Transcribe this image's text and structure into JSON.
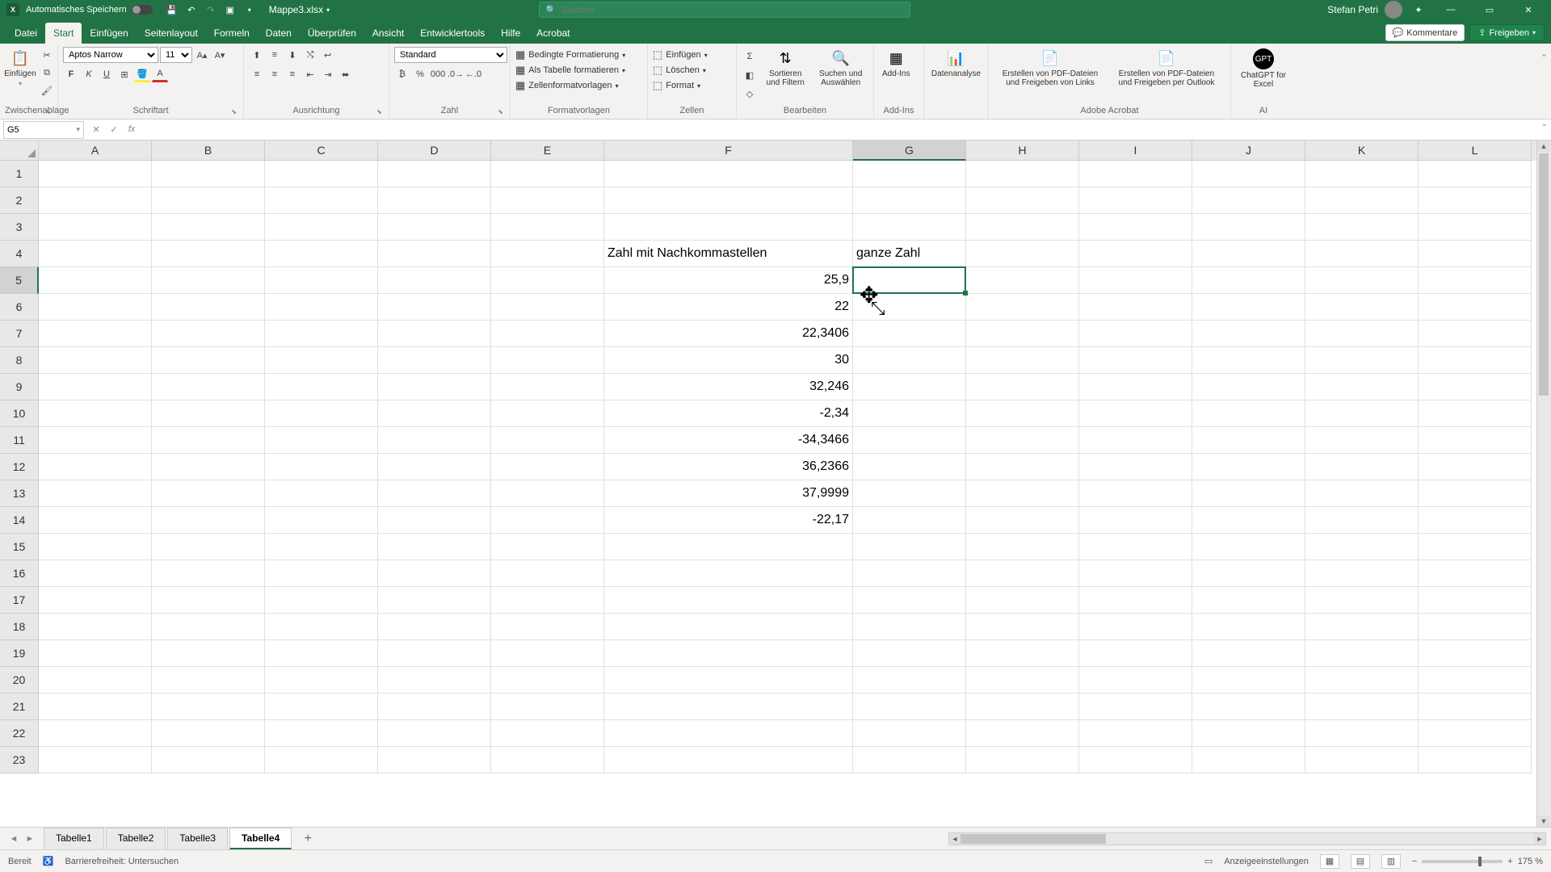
{
  "titlebar": {
    "autosave_label": "Automatisches Speichern",
    "filename": "Mappe3.xlsx",
    "search_placeholder": "Suchen",
    "username": "Stefan Petri"
  },
  "menu": {
    "tabs": [
      "Datei",
      "Start",
      "Einfügen",
      "Seitenlayout",
      "Formeln",
      "Daten",
      "Überprüfen",
      "Ansicht",
      "Entwicklertools",
      "Hilfe",
      "Acrobat"
    ],
    "active": "Start",
    "comments": "Kommentare",
    "share": "Freigeben"
  },
  "ribbon": {
    "clipboard": {
      "label": "Zwischenablage",
      "paste": "Einfügen"
    },
    "font": {
      "label": "Schriftart",
      "name": "Aptos Narrow",
      "size": "11"
    },
    "align": {
      "label": "Ausrichtung"
    },
    "number": {
      "label": "Zahl",
      "format": "Standard"
    },
    "styles": {
      "label": "Formatvorlagen",
      "cond": "Bedingte Formatierung",
      "table": "Als Tabelle formatieren",
      "cell": "Zellenformatvorlagen"
    },
    "cells": {
      "label": "Zellen",
      "insert": "Einfügen",
      "delete": "Löschen",
      "format": "Format"
    },
    "editing": {
      "label": "Bearbeiten",
      "sort": "Sortieren und Filtern",
      "find": "Suchen und Auswählen"
    },
    "addins": {
      "label": "Add-Ins",
      "addin": "Add-Ins"
    },
    "analysis": {
      "label": "",
      "data": "Datenanalyse"
    },
    "acrobat": {
      "label": "Adobe Acrobat",
      "pdf1": "Erstellen von PDF-Dateien und Freigeben von Links",
      "pdf2": "Erstellen von PDF-Dateien und Freigeben per Outlook"
    },
    "ai": {
      "label": "AI",
      "chatgpt": "ChatGPT for Excel"
    }
  },
  "fbar": {
    "cellref": "G5",
    "formula": ""
  },
  "columns": {
    "letters": [
      "A",
      "B",
      "C",
      "D",
      "E",
      "F",
      "G",
      "H",
      "I",
      "J",
      "K",
      "L"
    ],
    "widths": [
      140,
      140,
      140,
      140,
      140,
      308,
      140,
      140,
      140,
      140,
      140,
      140
    ],
    "selected": "G"
  },
  "rows": {
    "count": 23,
    "selected": 5
  },
  "data": {
    "F4": "Zahl mit Nachkommastellen",
    "G4": "ganze Zahl",
    "F5": "25,9",
    "F6": "22",
    "F7": "22,3406",
    "F8": "30",
    "F9": "32,246",
    "F10": "-2,34",
    "F11": "-34,3466",
    "F12": "36,2366",
    "F13": "37,9999",
    "F14": "-22,17"
  },
  "sheets": {
    "tabs": [
      "Tabelle1",
      "Tabelle2",
      "Tabelle3",
      "Tabelle4"
    ],
    "active": "Tabelle4"
  },
  "statusbar": {
    "ready": "Bereit",
    "access": "Barrierefreiheit: Untersuchen",
    "display": "Anzeigeeinstellungen",
    "zoom": "175 %"
  }
}
